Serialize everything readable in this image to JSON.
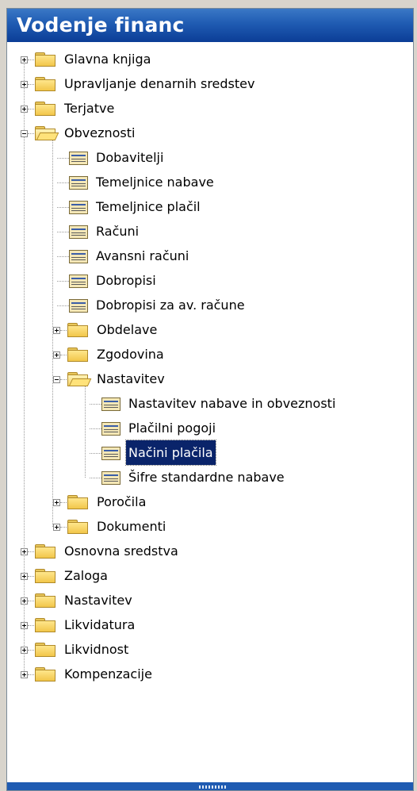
{
  "panel": {
    "title": "Vodenje financ"
  },
  "tree": [
    {
      "label": "Glavna knjiga",
      "level": 0,
      "kind": "folder",
      "expander": "plus"
    },
    {
      "label": "Upravljanje denarnih sredstev",
      "level": 0,
      "kind": "folder",
      "expander": "plus"
    },
    {
      "label": "Terjatve",
      "level": 0,
      "kind": "folder",
      "expander": "plus"
    },
    {
      "label": "Obveznosti",
      "level": 0,
      "kind": "folder-open",
      "expander": "minus"
    },
    {
      "label": "Dobavitelji",
      "level": 1,
      "kind": "form"
    },
    {
      "label": "Temeljnice nabave",
      "level": 1,
      "kind": "form"
    },
    {
      "label": "Temeljnice plačil",
      "level": 1,
      "kind": "form"
    },
    {
      "label": "Računi",
      "level": 1,
      "kind": "form"
    },
    {
      "label": "Avansni računi",
      "level": 1,
      "kind": "form"
    },
    {
      "label": "Dobropisi",
      "level": 1,
      "kind": "form"
    },
    {
      "label": "Dobropisi za av. račune",
      "level": 1,
      "kind": "form"
    },
    {
      "label": "Obdelave",
      "level": 1,
      "kind": "folder",
      "expander": "plus"
    },
    {
      "label": "Zgodovina",
      "level": 1,
      "kind": "folder",
      "expander": "plus"
    },
    {
      "label": "Nastavitev",
      "level": 1,
      "kind": "folder-open",
      "expander": "minus"
    },
    {
      "label": "Nastavitev nabave in obveznosti",
      "level": 2,
      "kind": "form"
    },
    {
      "label": "Plačilni pogoji",
      "level": 2,
      "kind": "form"
    },
    {
      "label": "Načini plačila",
      "level": 2,
      "kind": "form",
      "selected": true
    },
    {
      "label": "Šifre standardne nabave",
      "level": 2,
      "kind": "form"
    },
    {
      "label": "Poročila",
      "level": 1,
      "kind": "folder",
      "expander": "plus"
    },
    {
      "label": "Dokumenti",
      "level": 1,
      "kind": "folder",
      "expander": "plus"
    },
    {
      "label": "Osnovna sredstva",
      "level": 0,
      "kind": "folder",
      "expander": "plus"
    },
    {
      "label": "Zaloga",
      "level": 0,
      "kind": "folder",
      "expander": "plus"
    },
    {
      "label": "Nastavitev",
      "level": 0,
      "kind": "folder",
      "expander": "plus"
    },
    {
      "label": "Likvidatura",
      "level": 0,
      "kind": "folder",
      "expander": "plus"
    },
    {
      "label": "Likvidnost",
      "level": 0,
      "kind": "folder",
      "expander": "plus"
    },
    {
      "label": "Kompenzacije",
      "level": 0,
      "kind": "folder",
      "expander": "plus"
    }
  ],
  "colors": {
    "title_bar": "#1f5bb2",
    "selection": "#0a246a"
  }
}
